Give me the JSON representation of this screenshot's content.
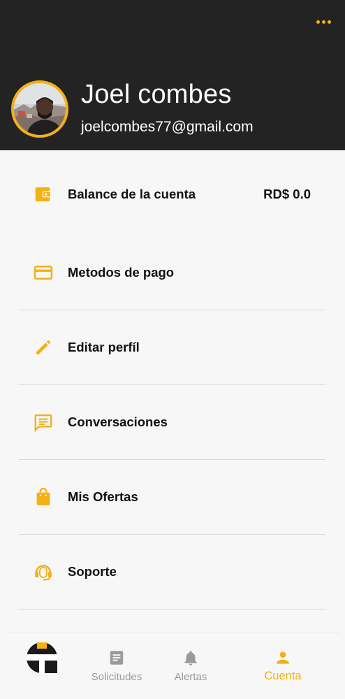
{
  "theme": {
    "accent": "#f5b014",
    "header_bg": "#232323",
    "background": "#f7f7f7",
    "inactive_nav": "#9a9a9a"
  },
  "header": {
    "more_icon": "more-horizontal-icon",
    "name": "Joel combes",
    "email": "joelcombes77@gmail.com"
  },
  "menu": {
    "items": [
      {
        "label": "Balance de la cuenta",
        "value": "RD$ 0.0",
        "icon": "wallet-icon"
      },
      {
        "label": "Metodos de pago",
        "icon": "credit-card-icon"
      },
      {
        "label": "Editar perfíl",
        "icon": "pencil-icon"
      },
      {
        "label": "Conversaciones",
        "icon": "chat-icon"
      },
      {
        "label": "Mis Ofertas",
        "icon": "shopping-bag-icon"
      },
      {
        "label": "Soporte",
        "icon": "headset-icon"
      }
    ]
  },
  "bottom_nav": {
    "logo_icon": "app-logo-icon",
    "items": [
      {
        "label": "Solicitudes",
        "icon": "document-icon",
        "active": false
      },
      {
        "label": "Alertas",
        "icon": "bell-icon",
        "active": false
      },
      {
        "label": "Cuenta",
        "icon": "person-icon",
        "active": true
      }
    ]
  }
}
